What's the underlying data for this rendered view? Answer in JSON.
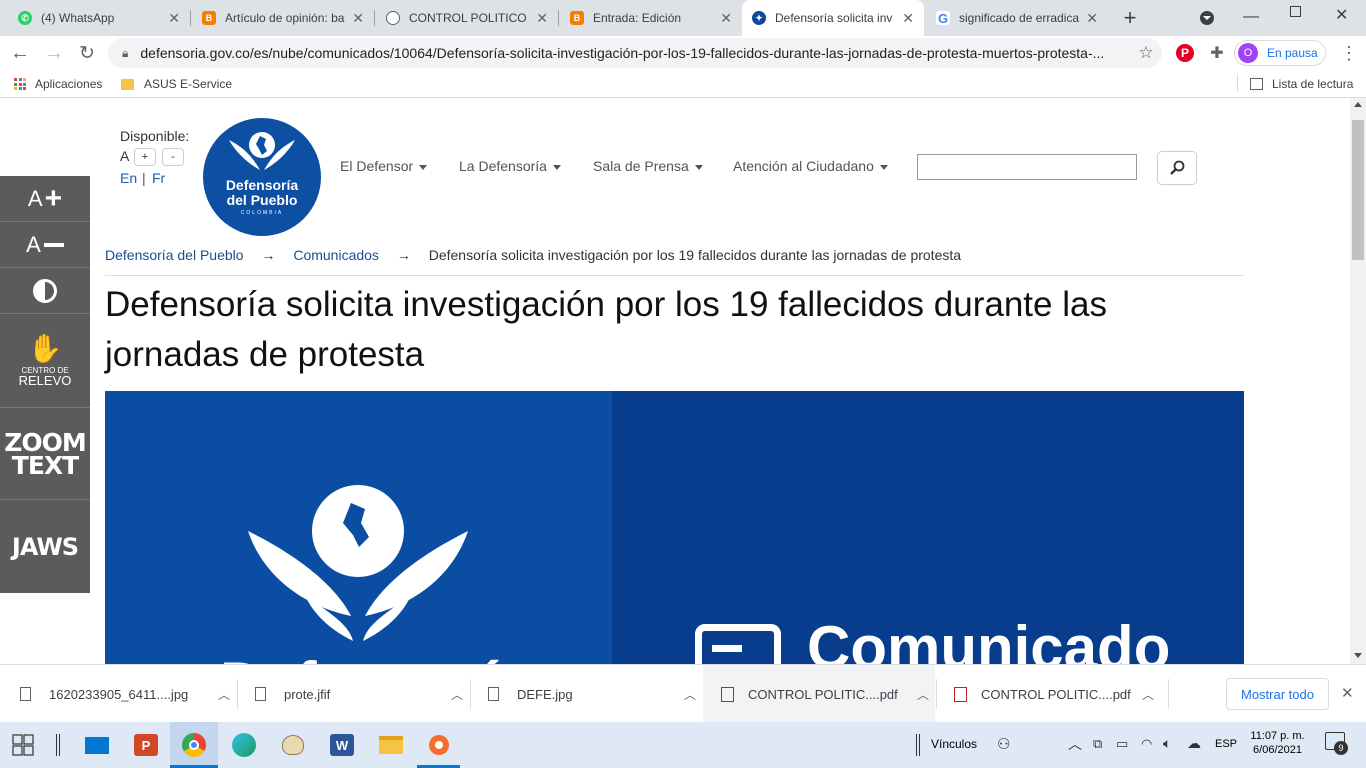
{
  "tabs": [
    {
      "title": "(4) WhatsApp",
      "icon": "whatsapp-icon",
      "color": "#25d366"
    },
    {
      "title": "Artículo de opinión: ba",
      "icon": "blogger-icon",
      "color": "#f57d00"
    },
    {
      "title": "CONTROL POLITICO Y",
      "icon": "globe-icon",
      "color": "#5f6368"
    },
    {
      "title": "Entrada: Edición",
      "icon": "blogger-icon",
      "color": "#f57d00"
    },
    {
      "title": "Defensoría solicita inv",
      "icon": "defensoria-icon",
      "color": "#0d47a1"
    },
    {
      "title": "significado de erradica",
      "icon": "google-icon",
      "color": "#4285f4"
    }
  ],
  "toolbar": {
    "url": "defensoria.gov.co/es/nube/comunicados/10064/Defensoría-solicita-investigación-por-los-19-fallecidos-durante-las-jornadas-de-protesta-muertos-protesta-...",
    "profile_initial": "O",
    "profile_status": "En pausa"
  },
  "bookmarks": {
    "apps": "Aplicaciones",
    "asus": "ASUS E-Service",
    "reading_list": "Lista de lectura"
  },
  "site": {
    "available": "Disponible:",
    "font_a": "A",
    "font_plus": "+",
    "font_minus": "-",
    "lang_en": "En",
    "lang_sep": "|",
    "lang_fr": "Fr",
    "logo_line1": "Defensoría",
    "logo_line2": "del Pueblo",
    "logo_line3": "COLOMBIA",
    "nav": [
      "El Defensor",
      "La Defensoría",
      "Sala de Prensa",
      "Atención al Ciudadano"
    ],
    "search_placeholder": ""
  },
  "accessibility": {
    "font_plus": "A",
    "font_minus": "A",
    "relevo_line1": "CENTRO DE",
    "relevo_line2": "RELEVO",
    "zoom_line1": "ZOOM",
    "zoom_line2": "TEXT",
    "jaws": "JAWS"
  },
  "breadcrumb": {
    "home": "Defensoría del Pueblo",
    "arrow": "→",
    "section": "Comunicados",
    "current": "Defensoría solicita investigación por los 19 fallecidos durante las jornadas de protesta"
  },
  "article": {
    "title": "Defensoría solicita investigación por los 19 fallecidos durante las jornadas de protesta",
    "banner_text": "Comunicado",
    "banner_logo_partial": "Defensoría"
  },
  "downloads": {
    "items": [
      {
        "name": "1620233905_6411....jpg",
        "type": "file"
      },
      {
        "name": "prote.jfif",
        "type": "file"
      },
      {
        "name": "DEFE.jpg",
        "type": "file"
      },
      {
        "name": "CONTROL POLITIC....pdf",
        "type": "pdf"
      },
      {
        "name": "CONTROL POLITIC....pdf",
        "type": "pdf"
      }
    ],
    "show_all": "Mostrar todo"
  },
  "taskbar": {
    "links": "Vínculos",
    "lang": "ESP",
    "time": "11:07 p. m.",
    "date": "6/06/2021",
    "notifications": "9"
  },
  "colors": {
    "brand_blue": "#0d4fa3",
    "banner_left": "#0a4da2",
    "banner_right": "#073d8c",
    "sidebar_gray": "#5b5b5b"
  }
}
